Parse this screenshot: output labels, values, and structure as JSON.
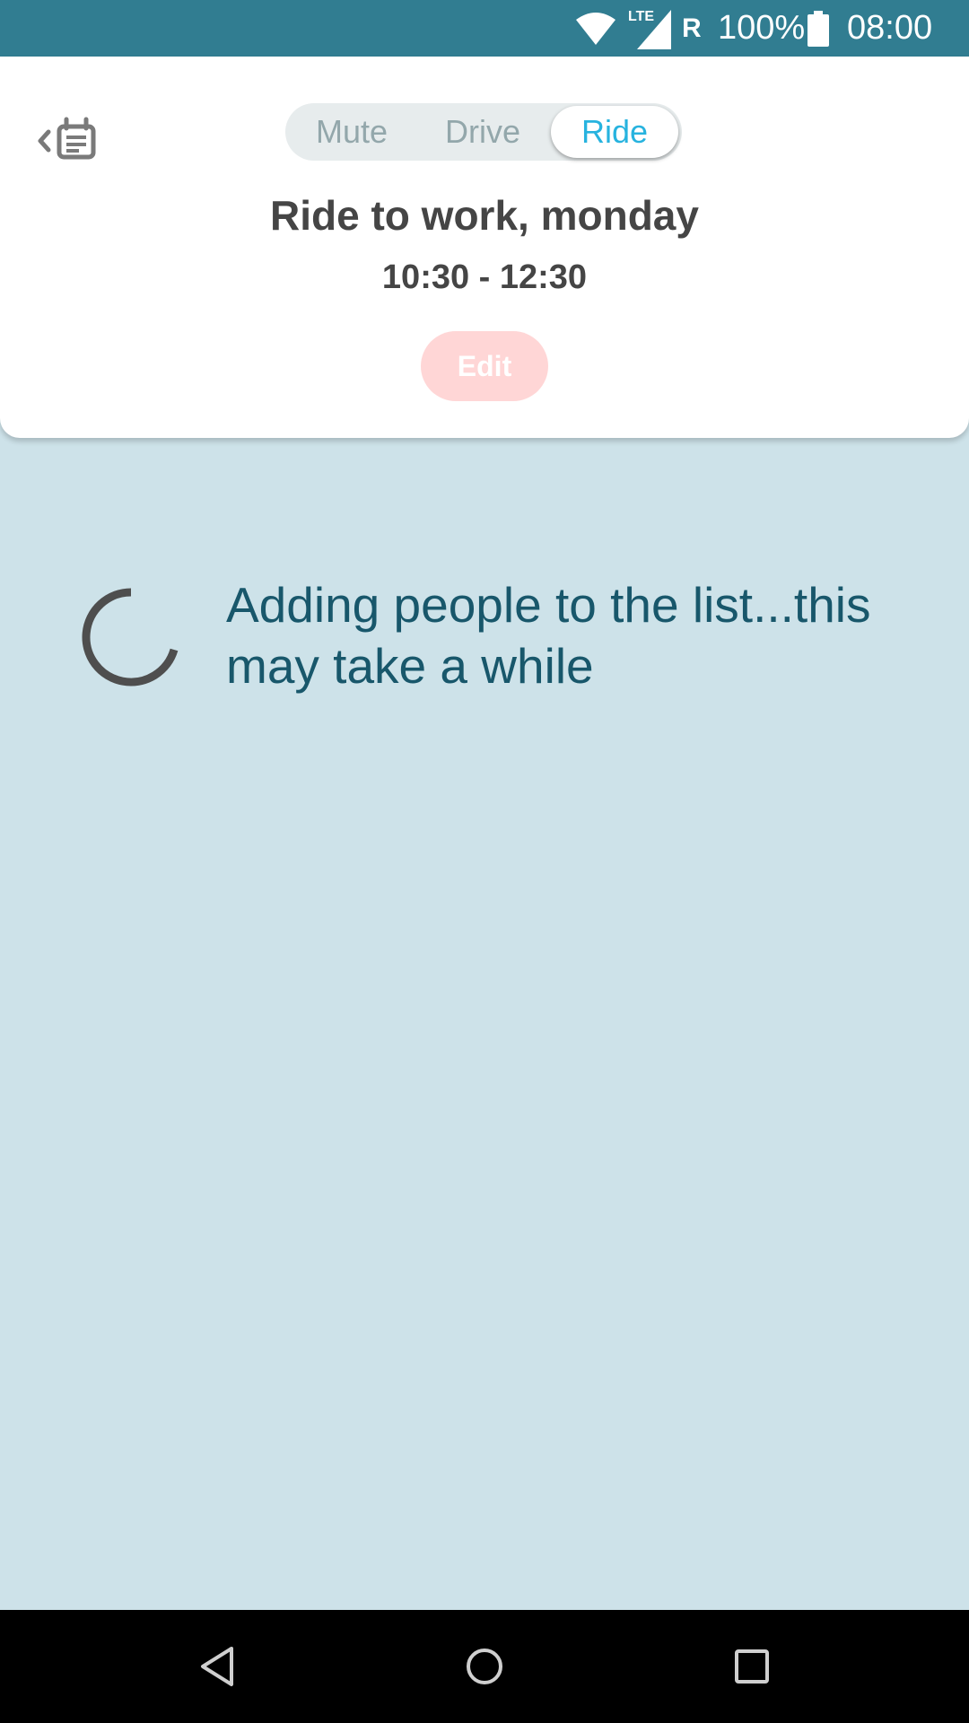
{
  "status_bar": {
    "network": "LTE",
    "roaming": "R",
    "battery_percent": "100%",
    "time": "08:00",
    "icons": [
      "wifi-icon",
      "signal-icon",
      "battery-icon"
    ]
  },
  "header": {
    "back_icon": "calendar-back-icon",
    "modes": [
      {
        "label": "Mute",
        "selected": false
      },
      {
        "label": "Drive",
        "selected": false
      },
      {
        "label": "Ride",
        "selected": true
      }
    ],
    "title": "Ride to work, monday",
    "time_range": "10:30 - 12:30",
    "edit_label": "Edit"
  },
  "loading": {
    "message": "Adding people to the list...this may take a while"
  },
  "nav_bar": {
    "icons": [
      "back-triangle-icon",
      "home-circle-icon",
      "recents-square-icon"
    ]
  },
  "colors": {
    "status_bar": "#317d91",
    "background": "#cde2e9",
    "accent": "#27b3df",
    "edit_button": "#ffd6d6",
    "loading_text": "#18576b"
  }
}
